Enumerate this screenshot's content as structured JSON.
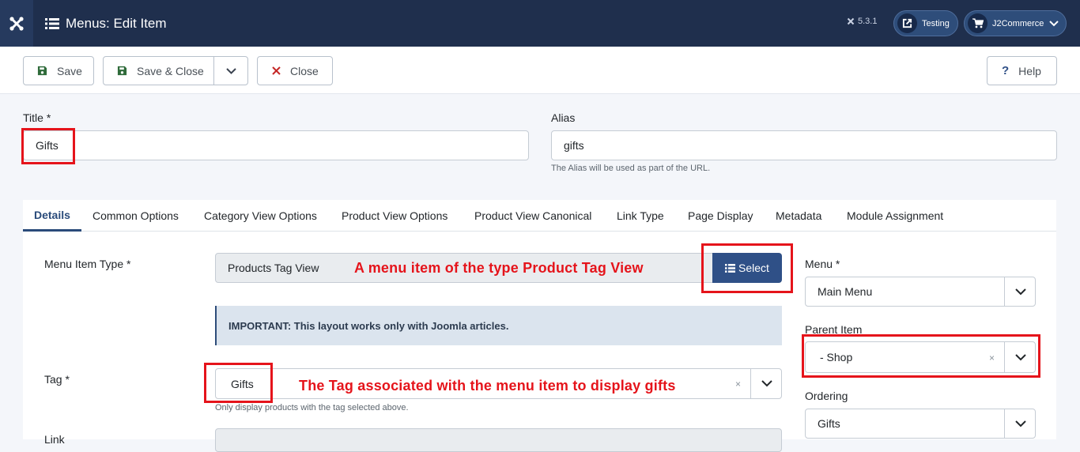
{
  "header": {
    "page_title": "Menus: Edit Item",
    "version": "5.3.1",
    "testing_label": "Testing",
    "j2commerce_label": "J2Commerce"
  },
  "toolbar": {
    "save_label": "Save",
    "save_close_label": "Save & Close",
    "close_label": "Close",
    "help_label": "Help"
  },
  "form": {
    "title_label": "Title *",
    "title_value": "Gifts",
    "alias_label": "Alias",
    "alias_value": "gifts",
    "alias_hint": "The Alias will be used as part of the URL."
  },
  "tabs": [
    {
      "label": "Details"
    },
    {
      "label": "Common Options"
    },
    {
      "label": "Category View Options"
    },
    {
      "label": "Product View Options"
    },
    {
      "label": "Product View Canonical"
    },
    {
      "label": "Link Type"
    },
    {
      "label": "Page Display"
    },
    {
      "label": "Metadata"
    },
    {
      "label": "Module Assignment"
    }
  ],
  "details": {
    "menu_item_type_label": "Menu Item Type *",
    "menu_item_type_value": "Products Tag View",
    "select_label": "Select",
    "notice": "IMPORTANT: This layout works only with Joomla articles.",
    "tag_label": "Tag *",
    "tag_value": "Gifts",
    "tag_hint": "Only display products with the tag selected above.",
    "tag_clear": "×",
    "link_label": "Link"
  },
  "sidebar": {
    "menu_label": "Menu *",
    "menu_value": "Main Menu",
    "parent_label": "Parent Item",
    "parent_value": "- Shop",
    "parent_clear": "×",
    "ordering_label": "Ordering",
    "ordering_value": "Gifts"
  },
  "annotations": {
    "menu_type_note": "A menu item of the type Product Tag View",
    "tag_note": "The Tag associated with the menu item to display gifts"
  },
  "colors": {
    "header_bg": "#1f2f4d",
    "accent": "#2f5087",
    "annotation_red": "#e5141b"
  }
}
